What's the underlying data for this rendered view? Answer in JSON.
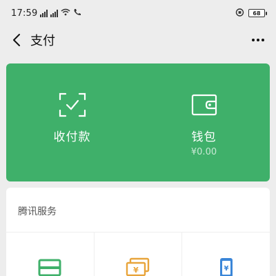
{
  "status_bar": {
    "time": "17:59",
    "battery": "68",
    "icons": [
      "signal-icon",
      "signal-icon",
      "wifi-icon",
      "call-icon",
      "alarm-icon",
      "battery-icon"
    ]
  },
  "nav": {
    "title": "支付",
    "back_icon": "chevron-left-icon",
    "more_icon": "more-dots-icon"
  },
  "pay_card": {
    "color": "#3fb06a",
    "items": [
      {
        "label": "收付款",
        "icon": "scan-check-icon"
      },
      {
        "label": "钱包",
        "sub": "¥0.00",
        "icon": "wallet-icon"
      }
    ]
  },
  "services": {
    "title": "腾讯服务",
    "items": [
      {
        "icon": "credit-card-icon",
        "color": "#3fb06a"
      },
      {
        "icon": "cash-stack-icon",
        "color": "#e8a43a"
      },
      {
        "icon": "mobile-recharge-icon",
        "color": "#3b86d8"
      }
    ]
  }
}
